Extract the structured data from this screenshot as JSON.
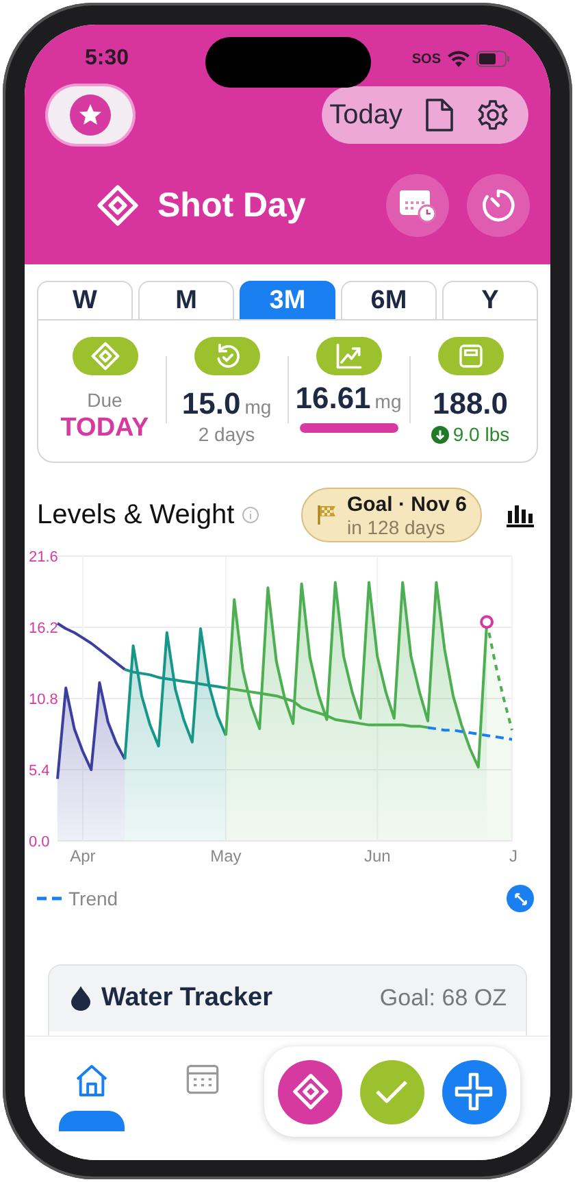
{
  "status_bar": {
    "time": "5:30",
    "carrier": "SOS"
  },
  "header": {
    "today_button": "Today",
    "title": "Shot Day"
  },
  "range_tabs": [
    {
      "label": "W",
      "selected": false
    },
    {
      "label": "M",
      "selected": false
    },
    {
      "label": "3M",
      "selected": true
    },
    {
      "label": "6M",
      "selected": false
    },
    {
      "label": "Y",
      "selected": false
    }
  ],
  "stats": [
    {
      "kind": "due",
      "label": "Due",
      "value": "TODAY"
    },
    {
      "kind": "dose",
      "value": "15.0",
      "unit": "mg",
      "sub": "2 days"
    },
    {
      "kind": "level",
      "value": "16.61",
      "unit": "mg",
      "level": 1
    },
    {
      "kind": "weight",
      "value": "188.0",
      "change": "9.0 lbs"
    }
  ],
  "chart_section": {
    "title": "Levels & Weight",
    "goal": {
      "title": "Goal · Nov 6",
      "subtitle": "in 128 days"
    },
    "chart_data": {
      "type": "area",
      "categories": [
        null,
        null,
        null,
        "Apr",
        null,
        null,
        null,
        null,
        null,
        null,
        null,
        null,
        null,
        null,
        null,
        null,
        null,
        null,
        null,
        null,
        "May",
        null,
        null,
        null,
        null,
        null,
        null,
        null,
        null,
        null,
        null,
        null,
        null,
        null,
        null,
        null,
        null,
        null,
        "Jun",
        null,
        null,
        null,
        null,
        null,
        null,
        null,
        null,
        null,
        null,
        null,
        null,
        null,
        null,
        null,
        "J"
      ],
      "ylim": [
        0,
        21.6
      ],
      "yticks": [
        {
          "value": 0,
          "label": "0.0"
        },
        {
          "value": 5.4,
          "label": "5.4"
        },
        {
          "value": 10.8,
          "label": "10.8"
        },
        {
          "value": 16.2,
          "label": "16.2"
        },
        {
          "value": 21.6,
          "label": "21.6"
        }
      ],
      "series": [
        {
          "color": "#3d3f9e",
          "values": [
            4.7,
            11.6,
            8.5,
            6.8,
            5.4,
            12.0,
            9.0,
            7.4,
            6.2,
            null,
            null,
            null,
            null,
            null,
            null,
            null,
            null,
            null,
            null,
            null,
            null,
            null,
            null,
            null,
            null,
            null,
            null,
            null,
            null,
            null,
            null,
            null,
            null,
            null,
            null,
            null,
            null,
            null,
            null,
            null,
            null,
            null,
            null,
            null,
            null,
            null,
            null,
            null,
            null,
            null,
            null,
            null,
            null,
            null,
            null
          ]
        },
        {
          "color": "#17978a",
          "values": [
            null,
            null,
            null,
            null,
            null,
            null,
            null,
            null,
            6.2,
            14.8,
            11.0,
            8.8,
            7.2,
            15.8,
            11.5,
            9.2,
            7.5,
            16.1,
            11.8,
            9.5,
            8.0,
            null,
            null,
            null,
            null,
            null,
            null,
            null,
            null,
            null,
            null,
            null,
            null,
            null,
            null,
            null,
            null,
            null,
            null,
            null,
            null,
            null,
            null,
            null,
            null,
            null,
            null,
            null,
            null,
            null,
            null,
            null,
            null,
            null,
            null
          ]
        },
        {
          "color": "#4daf52",
          "values": [
            null,
            null,
            null,
            null,
            null,
            null,
            null,
            null,
            null,
            null,
            null,
            null,
            null,
            null,
            null,
            null,
            null,
            null,
            null,
            null,
            8.0,
            18.3,
            13.0,
            10.3,
            8.5,
            19.2,
            13.6,
            10.8,
            8.9,
            19.5,
            13.9,
            11.1,
            9.2,
            19.6,
            14.0,
            11.3,
            9.3,
            19.6,
            14.0,
            11.3,
            9.3,
            19.6,
            14.0,
            11.3,
            9.1,
            19.6,
            14.5,
            11.0,
            8.8,
            7.0,
            5.6,
            16.6,
            null,
            null,
            null
          ]
        },
        {
          "color": "#4daf52",
          "line_style": "dashed",
          "values": [
            null,
            null,
            null,
            null,
            null,
            null,
            null,
            null,
            null,
            null,
            null,
            null,
            null,
            null,
            null,
            null,
            null,
            null,
            null,
            null,
            null,
            null,
            null,
            null,
            null,
            null,
            null,
            null,
            null,
            null,
            null,
            null,
            null,
            null,
            null,
            null,
            null,
            null,
            null,
            null,
            null,
            null,
            null,
            null,
            null,
            null,
            null,
            null,
            null,
            null,
            null,
            16.6,
            13.5,
            10.8,
            8.4
          ]
        }
      ],
      "grid": true
    },
    "overlay": {
      "chart_data": {
        "type": "line",
        "ylim": [
          0,
          21.6
        ],
        "series": [
          {
            "color": "#3d3f9e",
            "values": [
              16.5,
              16.1,
              15.8,
              15.4,
              15.0,
              14.5,
              14.0,
              13.5,
              13.0,
              null,
              null,
              null,
              null,
              null,
              null,
              null,
              null,
              null,
              null,
              null,
              null,
              null,
              null,
              null,
              null,
              null,
              null,
              null,
              null,
              null,
              null,
              null,
              null,
              null,
              null,
              null,
              null,
              null,
              null,
              null,
              null,
              null,
              null,
              null,
              null,
              null,
              null,
              null,
              null,
              null,
              null,
              null,
              null,
              null,
              null
            ]
          },
          {
            "color": "#17978a",
            "values": [
              null,
              null,
              null,
              null,
              null,
              null,
              null,
              null,
              13.0,
              12.8,
              12.7,
              12.6,
              12.4,
              12.3,
              12.2,
              12.1,
              12.0,
              11.9,
              11.8,
              11.7,
              11.6,
              null,
              null,
              null,
              null,
              null,
              null,
              null,
              null,
              null,
              null,
              null,
              null,
              null,
              null,
              null,
              null,
              null,
              null,
              null,
              null,
              null,
              null,
              null,
              null,
              null,
              null,
              null,
              null,
              null,
              null,
              null,
              null,
              null,
              null
            ]
          },
          {
            "color": "#4daf52",
            "values": [
              null,
              null,
              null,
              null,
              null,
              null,
              null,
              null,
              null,
              null,
              null,
              null,
              null,
              null,
              null,
              null,
              null,
              null,
              null,
              null,
              11.6,
              11.5,
              11.4,
              11.3,
              11.2,
              11.1,
              11.0,
              10.8,
              10.6,
              10.1,
              9.9,
              9.7,
              9.5,
              9.2,
              9.1,
              9.0,
              8.9,
              8.8,
              8.8,
              8.8,
              8.8,
              8.8,
              8.7,
              8.7,
              8.6,
              null,
              null,
              null,
              null,
              null,
              null,
              null,
              null,
              null,
              null
            ]
          },
          {
            "name": "Trend",
            "color": "#1a7ff0",
            "line_style": "dashed",
            "values": [
              null,
              null,
              null,
              null,
              null,
              null,
              null,
              null,
              null,
              null,
              null,
              null,
              null,
              null,
              null,
              null,
              null,
              null,
              null,
              null,
              null,
              null,
              null,
              null,
              null,
              null,
              null,
              null,
              null,
              null,
              null,
              null,
              null,
              null,
              null,
              null,
              null,
              null,
              null,
              null,
              null,
              null,
              null,
              null,
              8.6,
              8.5,
              8.4,
              8.4,
              8.3,
              8.2,
              8.1,
              8.0,
              7.9,
              7.8,
              7.7
            ]
          }
        ]
      }
    }
  },
  "water_tracker": {
    "title": "Water Tracker",
    "goal": "Goal: 68 OZ"
  },
  "nav": [
    {
      "kind": "home",
      "selected": true
    },
    {
      "kind": "calendar",
      "selected": false
    }
  ],
  "actions": [
    {
      "kind": "shot"
    },
    {
      "kind": "check"
    },
    {
      "kind": "add"
    }
  ]
}
